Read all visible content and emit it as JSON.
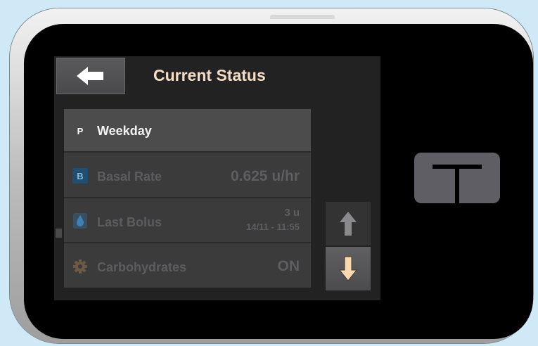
{
  "screen": {
    "title": "Current Status"
  },
  "icons": {
    "back": "left-arrow-icon",
    "scroll_up": "up-arrow-icon",
    "scroll_down": "down-arrow-icon",
    "home": "t-logo-icon"
  },
  "status_rows": [
    {
      "icon": "P",
      "label": "Weekday",
      "value": "",
      "active": true
    },
    {
      "icon": "B",
      "label": "Basal Rate",
      "value": "0.625 u/hr",
      "active": false
    },
    {
      "icon": "drop-icon",
      "label": "Last Bolus",
      "value": "3 u",
      "subvalue": "14/11 - 11:55",
      "active": false
    },
    {
      "icon": "gear-icon",
      "label": "Carbohydrates",
      "value": "ON",
      "active": false
    }
  ],
  "colors": {
    "title": "#f5dcc4",
    "down_arrow": "#fcd9ad",
    "up_arrow": "#8a8a8c",
    "screen_bg": "#222223",
    "page_bg": "#cfeaf6"
  }
}
